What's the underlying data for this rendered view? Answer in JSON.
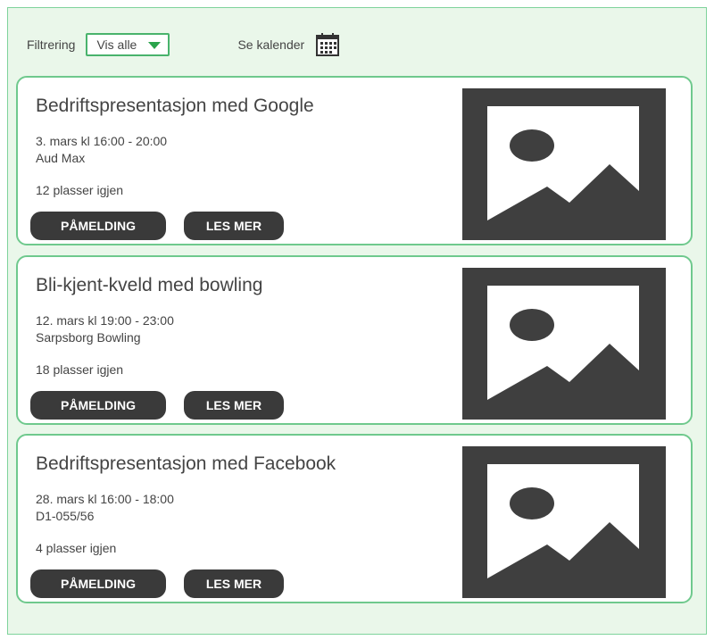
{
  "filter": {
    "label": "Filtrering",
    "selected": "Vis alle",
    "calendar_label": "Se kalender"
  },
  "events": [
    {
      "title": "Bedriftspresentasjon med Google",
      "date": "3. mars kl 16:00 - 20:00",
      "location": "Aud Max",
      "seats": "12 plasser igjen",
      "signup_label": "PÅMELDING",
      "more_label": "LES MER"
    },
    {
      "title": "Bli-kjent-kveld med bowling",
      "date": "12. mars kl 19:00 - 23:00",
      "location": "Sarpsborg Bowling",
      "seats": "18 plasser igjen",
      "signup_label": "PÅMELDING",
      "more_label": "LES MER"
    },
    {
      "title": "Bedriftspresentasjon med Facebook",
      "date": "28. mars kl 16:00 - 18:00",
      "location": "D1-055/56",
      "seats": "4 plasser igjen",
      "signup_label": "PÅMELDING",
      "more_label": "LES MER"
    }
  ],
  "colors": {
    "background": "#eaf7ea",
    "border_green": "#6fc98d",
    "button": "#3a3a3a",
    "placeholder": "#3f3f3f"
  },
  "icons": {
    "calendar": "calendar-icon",
    "dropdown": "chevron-down-icon",
    "image": "image-placeholder-icon"
  }
}
